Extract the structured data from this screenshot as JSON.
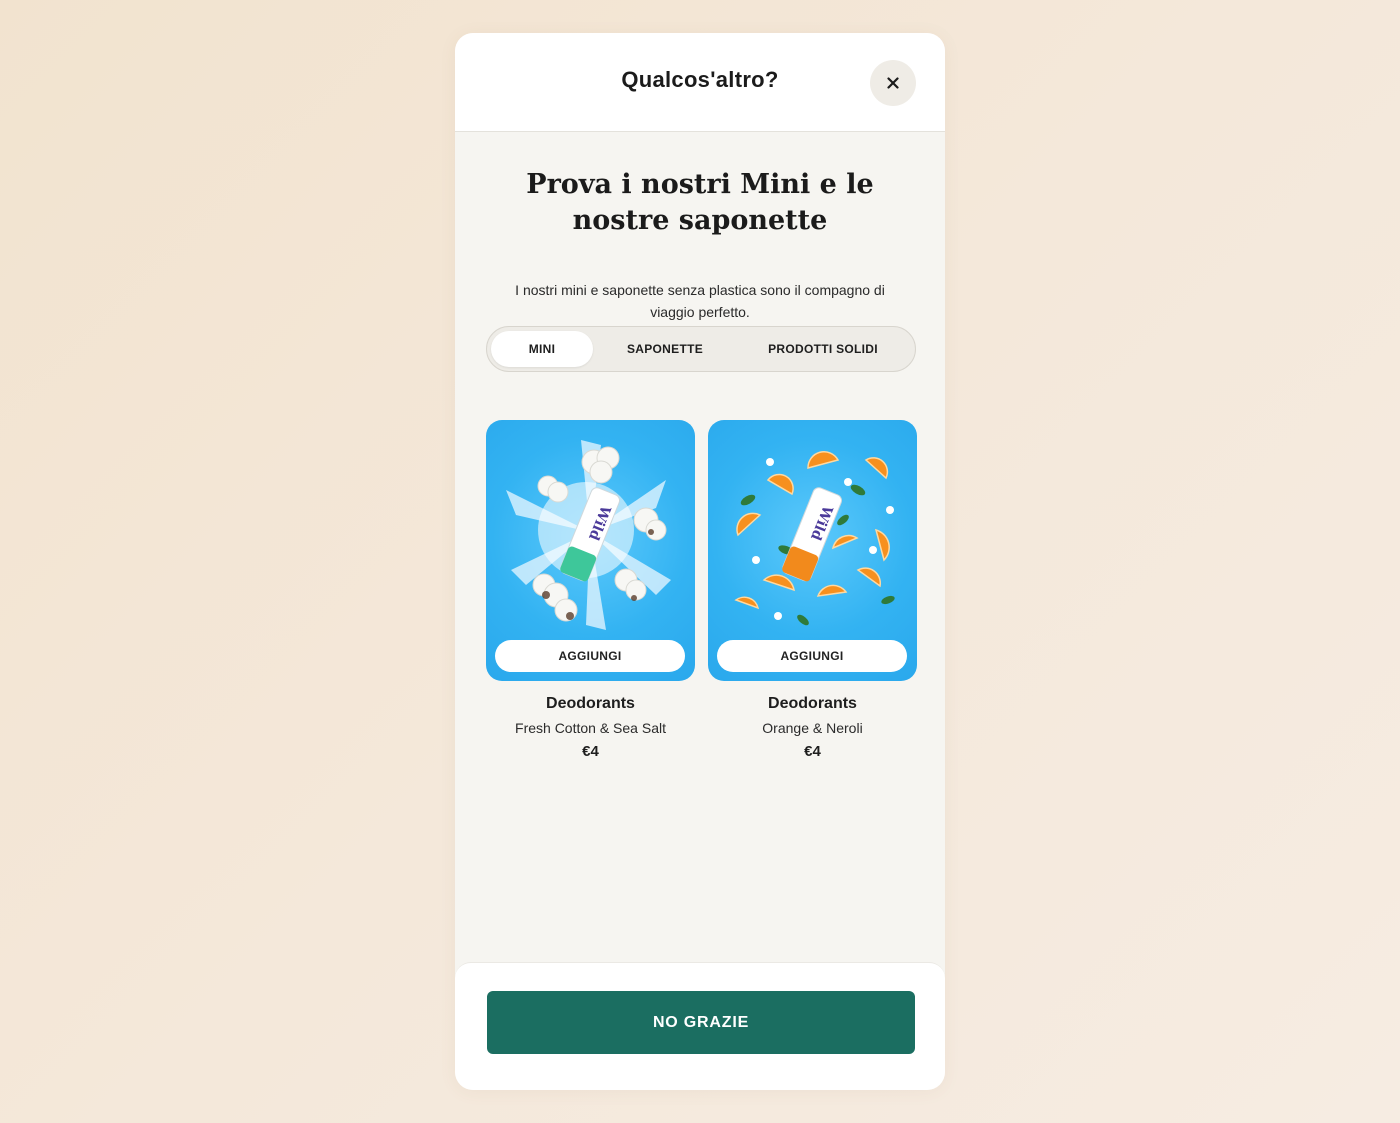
{
  "modal": {
    "title": "Qualcos'altro?",
    "close_icon": "close-icon"
  },
  "content": {
    "heading": "Prova i nostri Mini e le nostre saponette",
    "subtext": "I nostri mini e saponette senza plastica sono il compagno di viaggio perfetto."
  },
  "tabs": [
    {
      "label": "MINI",
      "active": true
    },
    {
      "label": "SAPONETTE",
      "active": false
    },
    {
      "label": "PRODOTTI SOLIDI",
      "active": false
    }
  ],
  "products": [
    {
      "name": "Deodorants",
      "variant": "Fresh Cotton & Sea Salt",
      "price": "€4",
      "button_label": "AGGIUNGI",
      "brand_mark": "Wild",
      "accent_color": "#3ec79a"
    },
    {
      "name": "Deodorants",
      "variant": "Orange & Neroli",
      "price": "€4",
      "button_label": "AGGIUNGI",
      "brand_mark": "Wild",
      "accent_color": "#f28a1c"
    }
  ],
  "footer": {
    "button_label": "NO GRAZIE"
  },
  "colors": {
    "primary_button": "#1b6e61",
    "card_background": "#33b3f2",
    "page_background": "#f3e6d6"
  }
}
